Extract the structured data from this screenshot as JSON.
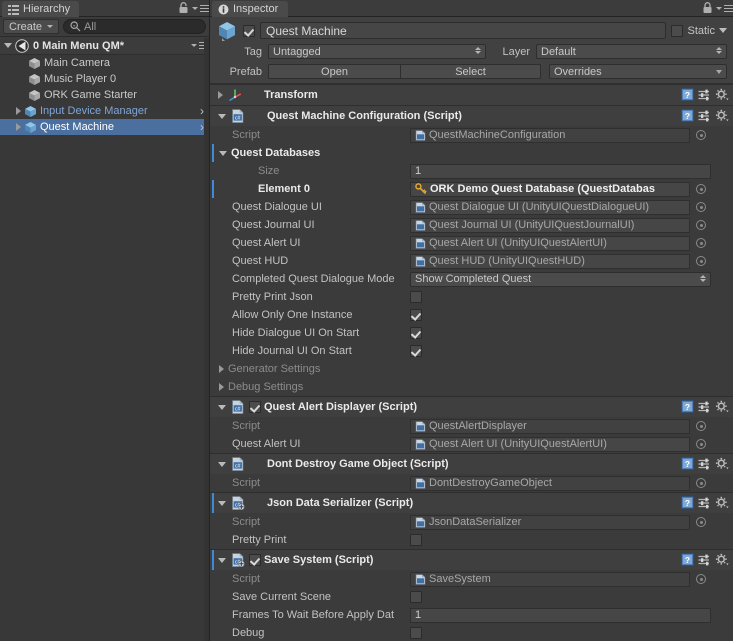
{
  "hierarchy": {
    "tab_label": "Hierarchy",
    "tab_icon": "hierarchy-icon",
    "lock_icon": "lock-icon",
    "menu_icon": "hamburger-menu-icon",
    "create_label": "Create",
    "search_placeholder": "All",
    "search_value": "All",
    "search_icon": "search-icon",
    "scene": {
      "label": "0 Main Menu QM*",
      "icon": "unity-scene-icon",
      "expanded": true
    },
    "items": [
      {
        "label": "Main Camera",
        "icon": "gameobject-cube-icon",
        "prefab": false,
        "expandable": false,
        "selected": false,
        "chevron": false
      },
      {
        "label": "Music Player 0",
        "icon": "gameobject-cube-icon",
        "prefab": false,
        "expandable": false,
        "selected": false,
        "chevron": false
      },
      {
        "label": "ORK Game Starter",
        "icon": "gameobject-cube-icon",
        "prefab": false,
        "expandable": false,
        "selected": false,
        "chevron": false
      },
      {
        "label": "Input Device Manager",
        "icon": "prefab-cube-icon",
        "prefab": true,
        "expandable": true,
        "selected": false,
        "chevron": true
      },
      {
        "label": "Quest Machine",
        "icon": "prefab-cube-icon",
        "prefab": true,
        "expandable": true,
        "selected": true,
        "chevron": true
      }
    ]
  },
  "inspector": {
    "tab_label": "Inspector",
    "tab_icon": "info-icon",
    "lock_icon": "lock-icon",
    "menu_icon": "hamburger-menu-icon",
    "object": {
      "icon": "prefab-cube-icon",
      "enabled": true,
      "name": "Quest Machine",
      "static_label": "Static",
      "static_checked": false
    },
    "tag_label": "Tag",
    "tag_value": "Untagged",
    "layer_label": "Layer",
    "layer_value": "Default",
    "prefab_label": "Prefab",
    "prefab_open": "Open",
    "prefab_select": "Select",
    "prefab_overrides": "Overrides",
    "components": [
      {
        "title": "Transform",
        "icon": "transform-axis-icon",
        "expanded": false,
        "has_toggle": false,
        "header_icons": [
          "help-icon",
          "preset-icon",
          "gear-icon"
        ],
        "rows": []
      },
      {
        "title": "Quest Machine Configuration (Script)",
        "icon": "csharp-script-icon",
        "expanded": true,
        "has_toggle": false,
        "header_icons": [
          "help-icon",
          "preset-icon",
          "gear-icon"
        ],
        "rows": [
          {
            "type": "object",
            "label": "Script",
            "label_style": "dim",
            "value": "QuestMachineConfiguration",
            "value_icon": "script-asset-icon",
            "readonly": true,
            "picker": true
          },
          {
            "type": "foldout",
            "label": "Quest Databases",
            "label_style": "bold",
            "expanded": true,
            "override": true
          },
          {
            "type": "text",
            "label": "Size",
            "label_style": "dim",
            "indent": 2,
            "value": "1"
          },
          {
            "type": "object",
            "label": "Element 0",
            "label_style": "bold",
            "indent": 2,
            "value": "ORK Demo Quest Database (QuestDatabas",
            "value_icon": "prefab-variant-icon",
            "value_style": "bold",
            "picker": true,
            "override": true
          },
          {
            "type": "object",
            "label": "Quest Dialogue UI",
            "value": "Quest Dialogue UI (UnityUIQuestDialogueUI)",
            "value_icon": "script-asset-icon",
            "picker": true
          },
          {
            "type": "object",
            "label": "Quest Journal UI",
            "value": "Quest Journal UI (UnityUIQuestJournalUI)",
            "value_icon": "script-asset-icon",
            "picker": true
          },
          {
            "type": "object",
            "label": "Quest Alert UI",
            "value": "Quest Alert UI (UnityUIQuestAlertUI)",
            "value_icon": "script-asset-icon",
            "picker": true
          },
          {
            "type": "object",
            "label": "Quest HUD",
            "value": "Quest HUD (UnityUIQuestHUD)",
            "value_icon": "script-asset-icon",
            "picker": true
          },
          {
            "type": "popup",
            "label": "Completed Quest Dialogue Mode",
            "value": "Show Completed Quest"
          },
          {
            "type": "check",
            "label": "Pretty Print Json",
            "checked": false
          },
          {
            "type": "check",
            "label": "Allow Only One Instance",
            "checked": true
          },
          {
            "type": "check",
            "label": "Hide Dialogue UI On Start",
            "checked": true
          },
          {
            "type": "check",
            "label": "Hide Journal UI On Start",
            "checked": true
          },
          {
            "type": "foldout",
            "label": "Generator Settings",
            "label_style": "dim",
            "expanded": false
          },
          {
            "type": "foldout",
            "label": "Debug Settings",
            "label_style": "dim",
            "expanded": false
          }
        ]
      },
      {
        "title": "Quest Alert Displayer (Script)",
        "icon": "csharp-script-icon",
        "expanded": true,
        "has_toggle": true,
        "toggle_checked": true,
        "header_icons": [
          "help-icon",
          "preset-icon",
          "gear-icon"
        ],
        "rows": [
          {
            "type": "object",
            "label": "Script",
            "label_style": "dim",
            "value": "QuestAlertDisplayer",
            "value_icon": "script-asset-icon",
            "readonly": true,
            "picker": true
          },
          {
            "type": "object",
            "label": "Quest Alert UI",
            "value": "Quest Alert UI (UnityUIQuestAlertUI)",
            "value_icon": "script-asset-icon",
            "picker": true
          }
        ]
      },
      {
        "title": "Dont Destroy Game Object (Script)",
        "icon": "csharp-script-icon",
        "expanded": true,
        "has_toggle": false,
        "header_icons": [
          "help-icon",
          "preset-icon",
          "gear-icon"
        ],
        "rows": [
          {
            "type": "object",
            "label": "Script",
            "label_style": "dim",
            "value": "DontDestroyGameObject",
            "value_icon": "script-asset-icon",
            "readonly": true,
            "picker": true
          }
        ]
      },
      {
        "title": "Json Data Serializer (Script)",
        "icon": "csharp-script-add-icon",
        "expanded": true,
        "has_toggle": false,
        "override": true,
        "header_icons": [
          "help-icon",
          "preset-icon",
          "gear-icon"
        ],
        "rows": [
          {
            "type": "object",
            "label": "Script",
            "label_style": "dim",
            "value": "JsonDataSerializer",
            "value_icon": "script-asset-icon",
            "readonly": true,
            "picker": true
          },
          {
            "type": "check",
            "label": "Pretty Print",
            "checked": false
          }
        ]
      },
      {
        "title": "Save System (Script)",
        "icon": "csharp-script-add-icon",
        "expanded": true,
        "has_toggle": true,
        "toggle_checked": true,
        "override": true,
        "header_icons": [
          "help-icon",
          "preset-icon",
          "gear-icon"
        ],
        "rows": [
          {
            "type": "object",
            "label": "Script",
            "label_style": "dim",
            "value": "SaveSystem",
            "value_icon": "script-asset-icon",
            "readonly": true,
            "picker": true
          },
          {
            "type": "check",
            "label": "Save Current Scene",
            "checked": false
          },
          {
            "type": "text",
            "label": "Frames To Wait Before Apply Dat",
            "value": "1",
            "wide": true
          },
          {
            "type": "check",
            "label": "Debug",
            "checked": false
          }
        ]
      }
    ]
  },
  "colors": {
    "panel_bg": "#383838",
    "inspector_bg": "#3b3b3b",
    "header_bg": "#414141",
    "selection_blue": "#4b6f9e",
    "prefab_text_blue": "#7fa5d8",
    "override_strip": "#3d8bd8",
    "prefab_variant_orange": "#d8a23c",
    "script_icon_blue": "#6f9fd8"
  }
}
